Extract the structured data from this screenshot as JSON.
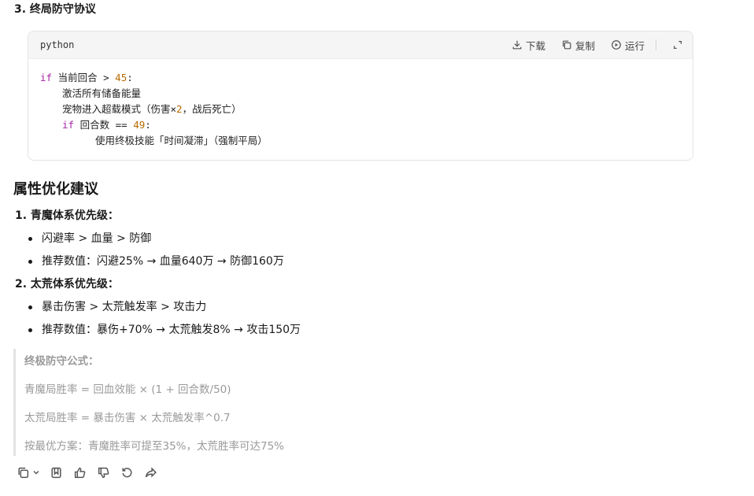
{
  "section3": {
    "title": "3. 终局防守协议"
  },
  "codeblock": {
    "language": "python",
    "actions": {
      "download": "下载",
      "copy": "复制",
      "run": "运行"
    },
    "lines": [
      {
        "kw": "if",
        "text": " 当前回合 > ",
        "num": "45",
        "tail": ":"
      },
      {
        "text": "激活所有储备能量"
      },
      {
        "text": "宠物进入超载模式（伤害×",
        "num": "2",
        "tail": "，战后死亡）"
      },
      {
        "kw": "if",
        "text": " 回合数 == ",
        "num": "49",
        "tail": ":"
      },
      {
        "text": "使用终极技能「时间凝滞」（强制平局）"
      }
    ]
  },
  "section": {
    "title": "属性优化建议"
  },
  "list": {
    "item1": {
      "heading": "1. 青魔体系优先级：",
      "bullets": [
        "闪避率 > 血量 > 防御",
        "推荐数值：闪避25% → 血量640万 → 防御160万"
      ]
    },
    "item2": {
      "heading": "2. 太荒体系优先级：",
      "bullets": [
        "暴击伤害 > 太荒触发率 > 攻击力",
        "推荐数值：暴伤+70% → 太荒触发8% → 攻击150万"
      ]
    }
  },
  "quote": {
    "title": "终极防守公式：",
    "lines": [
      "青魔局胜率 = 回血效能 × (1 + 回合数/50)",
      "太荒局胜率 = 暴击伤害 × 太荒触发率^0.7",
      "按最优方案：青魔胜率可提至35%，太荒胜率可达75%"
    ]
  },
  "icons": [
    "copy-icon",
    "chevron-down-icon",
    "bookmark-icon",
    "thumbs-up-icon",
    "thumbs-down-icon",
    "regenerate-icon",
    "share-icon"
  ]
}
